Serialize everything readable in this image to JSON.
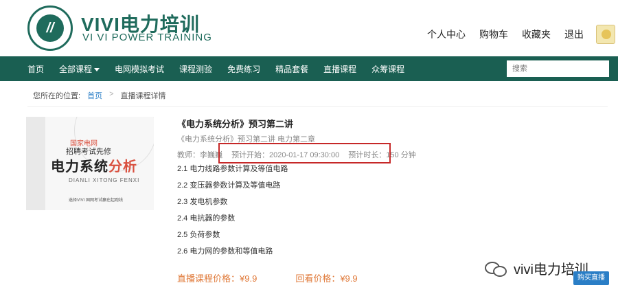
{
  "header": {
    "logo_brand": "VIVI电力培训",
    "logo_sub": "VI VI POWER TRAINING",
    "logo_mark": "//",
    "user_nav": [
      "个人中心",
      "购物车",
      "收藏夹",
      "退出"
    ]
  },
  "navbar": {
    "items": [
      "首页",
      "全部课程",
      "电网模拟考试",
      "课程测验",
      "免费练习",
      "精品套餐",
      "直播课程",
      "众筹课程"
    ],
    "search_placeholder": "搜索"
  },
  "breadcrumb": {
    "prefix": "您所在的位置:",
    "home": "首页",
    "separator": ">",
    "current": "直播课程详情"
  },
  "cover": {
    "line1": "国家电网",
    "line2": "招聘考试先修",
    "title_a": "电力系统",
    "title_b": "分析",
    "pinyin": "DIANLI XITONG FENXI",
    "bottom": "选择VIVI 国网考试赢在起跑线"
  },
  "course": {
    "title": "《电力系统分析》预习第二讲",
    "subtitle": "《电力系统分析》预习第二讲 电力第二章",
    "teacher": "教师：李巍巍",
    "start": "预计开始：2020-01-17 09:30:00",
    "duration": "预计时长：150 分钟",
    "chapters": [
      "2.1 电力线路参数计算及等值电路",
      "2.2 变压器参数计算及等值电路",
      "2.3 发电机参数",
      "2.4 电抗器的参数",
      "2.5 负荷参数",
      "2.6 电力网的参数和等值电路"
    ]
  },
  "prices": {
    "live": "直播课程价格：¥9.9",
    "replay": "回看价格：¥9.9"
  },
  "watermark": "vivi电力培训",
  "buy_button": "购买直播",
  "colors": {
    "brand_green": "#1a5f52",
    "price_orange": "#e07a3a",
    "highlight_red": "#c62828",
    "link_blue": "#2a7ec6"
  }
}
